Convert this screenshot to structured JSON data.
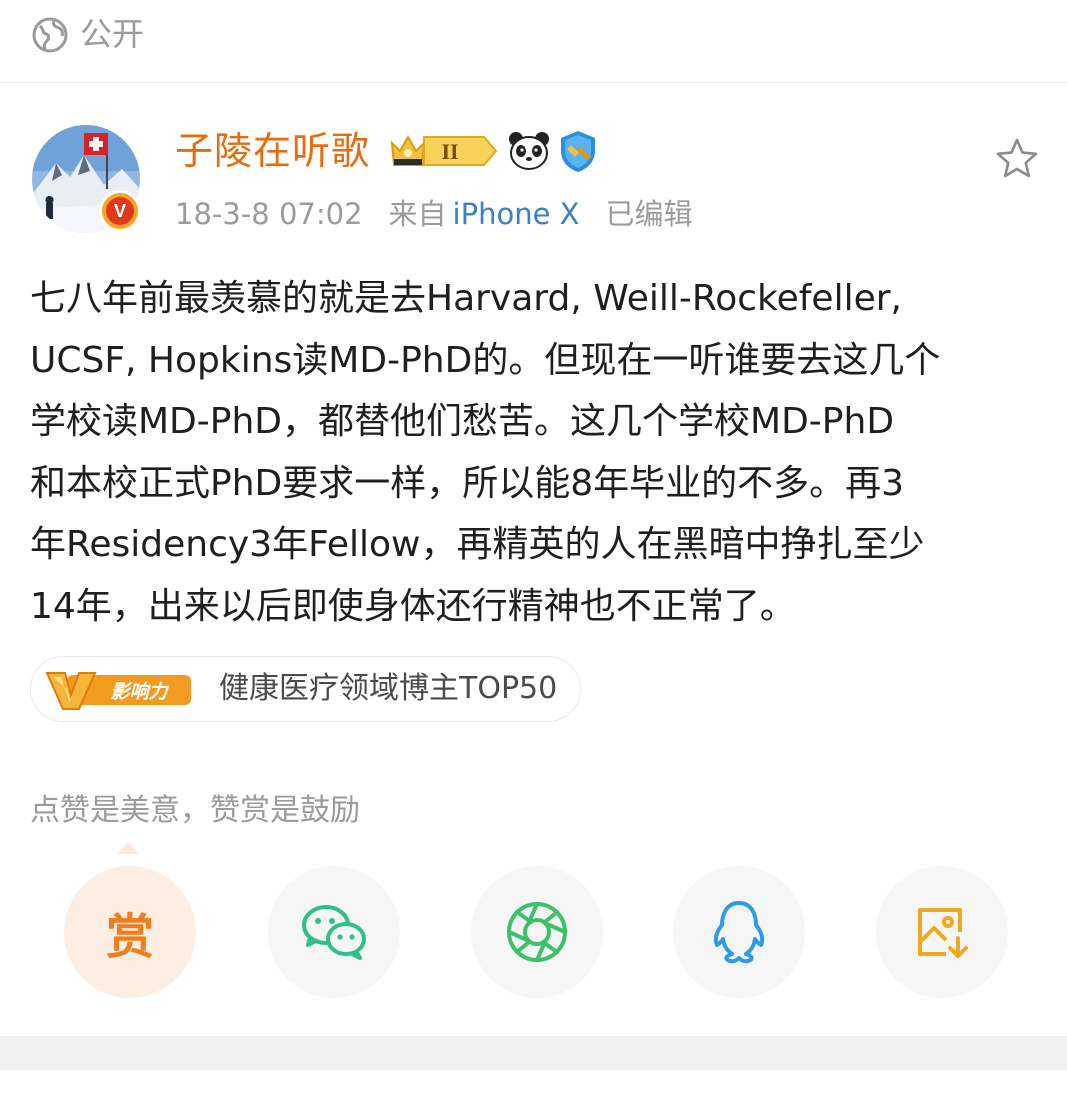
{
  "visibility": {
    "icon": "globe-icon",
    "label": "公开"
  },
  "author": {
    "name": "子陵在听歌",
    "avatar_icon": "mountain-landscape-avatar",
    "verified_icon": "verified-v-badge",
    "badges": [
      "crown-level-badge",
      "panda-icon",
      "shield-icon"
    ],
    "level_label": "II"
  },
  "meta": {
    "time": "18-3-8 07:02",
    "source_prefix": "来自",
    "source": "iPhone X",
    "edited": "已编辑"
  },
  "post": {
    "lines": [
      "七八年前最羡慕的就是去Harvard, Weill-Rockefeller,",
      "UCSF, Hopkins读MD-PhD的。但现在一听谁要去这几个",
      "学校读MD-PhD，都替他们愁苦。这几个学校MD-PhD",
      "和本校正式PhD要求一样，所以能8年毕业的不多。再3",
      "年Residency3年Fellow，再精英的人在黑暗中挣扎至少",
      "14年，出来以后即使身体还行精神也不正常了。"
    ]
  },
  "influence": {
    "icon_text": "影响力",
    "label": "健康医疗领域博主TOP50"
  },
  "reward_hint": "点赞是美意，赞赏是鼓励",
  "share": {
    "reward_label": "赏",
    "items": [
      "reward-button",
      "wechat-icon",
      "moments-icon",
      "qq-icon",
      "save-image-icon"
    ]
  },
  "colors": {
    "username": "#e86b0e",
    "link": "#3d7fc7",
    "accent": "#f07e1d",
    "meta": "#9b9b9b"
  }
}
